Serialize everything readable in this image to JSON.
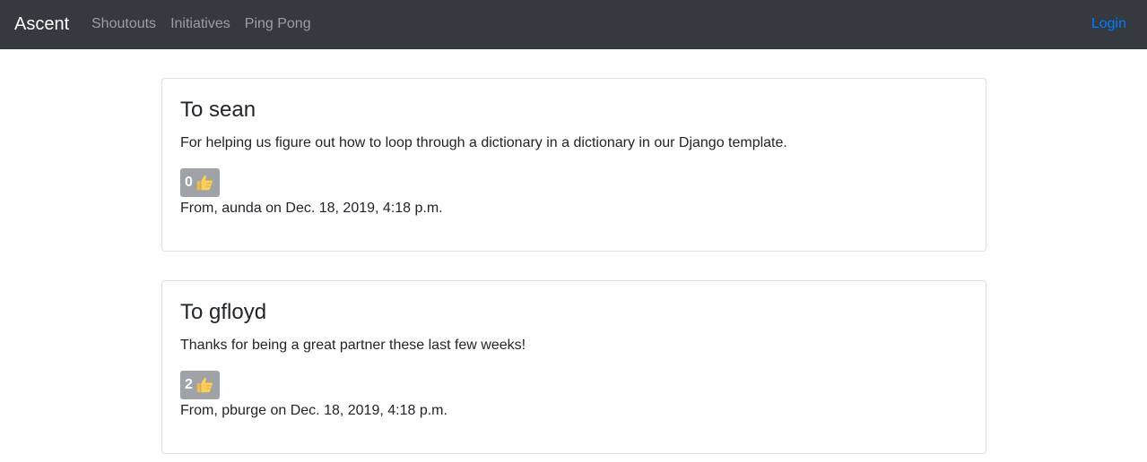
{
  "navbar": {
    "brand": "Ascent",
    "links": [
      "Shoutouts",
      "Initiatives",
      "Ping Pong"
    ],
    "login": "Login"
  },
  "shoutouts": [
    {
      "title": "To sean",
      "message": "For helping us figure out how to loop through a dictionary in a dictionary in our Django template.",
      "likes": "0",
      "from": "From, aunda on Dec. 18, 2019, 4:18 p.m."
    },
    {
      "title": "To gfloyd",
      "message": "Thanks for being a great partner these last few weeks!",
      "likes": "2",
      "from": "From, pburge on Dec. 18, 2019, 4:18 p.m."
    }
  ],
  "colors": {
    "navbar_bg": "#343a40",
    "link_active": "#007bff",
    "like_button_bg": "#9fa3a7"
  },
  "icons": {
    "like": "thumbs-up-icon"
  }
}
